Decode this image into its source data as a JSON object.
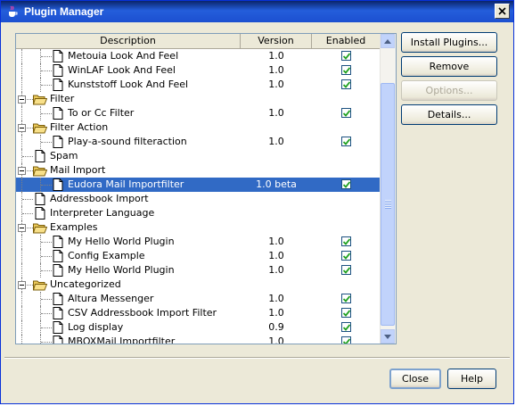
{
  "window": {
    "title": "Plugin Manager"
  },
  "table": {
    "columns": [
      "Description",
      "Version",
      "Enabled"
    ],
    "rows": [
      {
        "label": "Metouia Look And Feel",
        "version": "1.0",
        "enabled": true,
        "level": 2,
        "kind": "leaf",
        "selected": false
      },
      {
        "label": "WinLAF Look And Feel",
        "version": "1.0",
        "enabled": true,
        "level": 2,
        "kind": "leaf",
        "selected": false
      },
      {
        "label": "Kunststoff Look And Feel",
        "version": "1.0",
        "enabled": true,
        "level": 2,
        "kind": "leaf",
        "selected": false
      },
      {
        "label": "Filter",
        "version": "",
        "enabled": null,
        "level": 1,
        "kind": "folder",
        "selected": false
      },
      {
        "label": "To or Cc Filter",
        "version": "1.0",
        "enabled": true,
        "level": 2,
        "kind": "leaf",
        "selected": false
      },
      {
        "label": "Filter Action",
        "version": "",
        "enabled": null,
        "level": 1,
        "kind": "folder",
        "selected": false
      },
      {
        "label": "Play-a-sound filteraction",
        "version": "1.0",
        "enabled": true,
        "level": 2,
        "kind": "leaf",
        "selected": false
      },
      {
        "label": "Spam",
        "version": "",
        "enabled": null,
        "level": 1,
        "kind": "doc",
        "selected": false
      },
      {
        "label": "Mail Import",
        "version": "",
        "enabled": null,
        "level": 1,
        "kind": "folder",
        "selected": false
      },
      {
        "label": "Eudora Mail Importfilter",
        "version": "1.0 beta",
        "enabled": true,
        "level": 2,
        "kind": "leaf",
        "selected": true
      },
      {
        "label": "Addressbook Import",
        "version": "",
        "enabled": null,
        "level": 1,
        "kind": "doc",
        "selected": false
      },
      {
        "label": "Interpreter Language",
        "version": "",
        "enabled": null,
        "level": 1,
        "kind": "doc",
        "selected": false
      },
      {
        "label": "Examples",
        "version": "",
        "enabled": null,
        "level": 1,
        "kind": "folder",
        "selected": false
      },
      {
        "label": "My Hello World Plugin",
        "version": "1.0",
        "enabled": true,
        "level": 2,
        "kind": "leaf",
        "selected": false
      },
      {
        "label": "Config Example",
        "version": "1.0",
        "enabled": true,
        "level": 2,
        "kind": "leaf",
        "selected": false
      },
      {
        "label": "My Hello World Plugin",
        "version": "1.0",
        "enabled": true,
        "level": 2,
        "kind": "leaf",
        "selected": false
      },
      {
        "label": "Uncategorized",
        "version": "",
        "enabled": null,
        "level": 1,
        "kind": "folder",
        "selected": false
      },
      {
        "label": "Altura Messenger",
        "version": "1.0",
        "enabled": true,
        "level": 2,
        "kind": "leaf",
        "selected": false
      },
      {
        "label": "CSV Addressbook Import Filter",
        "version": "1.0",
        "enabled": true,
        "level": 2,
        "kind": "leaf",
        "selected": false
      },
      {
        "label": "Log display",
        "version": "0.9",
        "enabled": true,
        "level": 2,
        "kind": "leaf",
        "selected": false
      },
      {
        "label": "MBOXMail Importfilter",
        "version": "1.0",
        "enabled": true,
        "level": 2,
        "kind": "leaf",
        "selected": false
      }
    ]
  },
  "buttons": {
    "install": "Install Plugins...",
    "remove": "Remove",
    "options": "Options...",
    "details": "Details...",
    "close": "Close",
    "help": "Help"
  },
  "icons": {
    "app": "java-cup-icon",
    "folder": "folder-open-icon",
    "doc": "document-icon"
  }
}
